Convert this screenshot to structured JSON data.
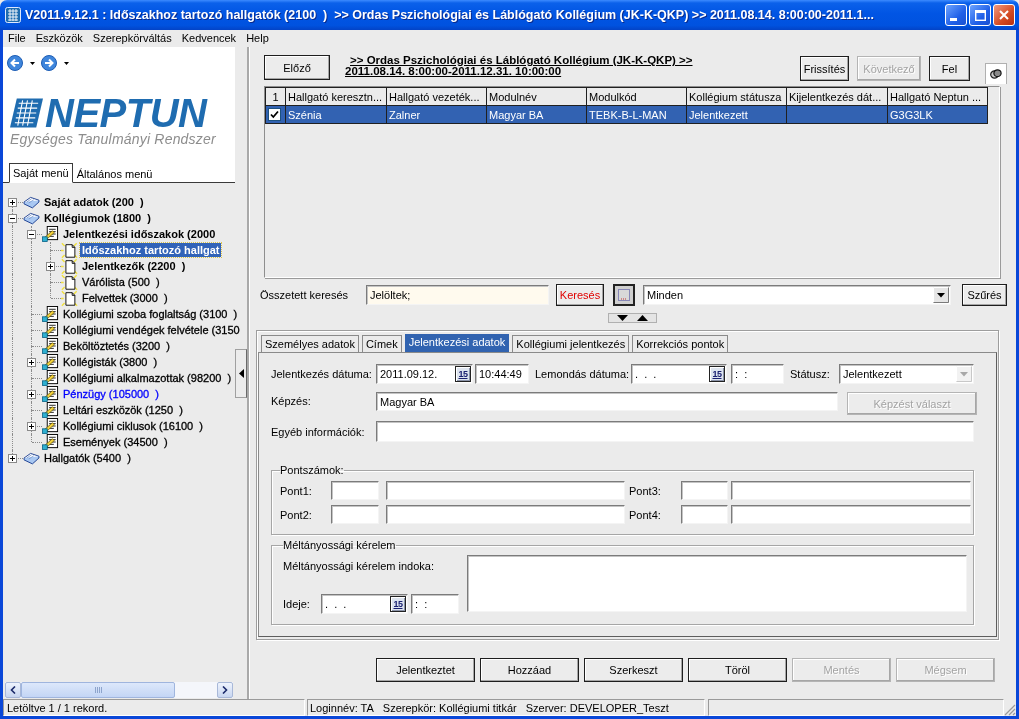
{
  "window": {
    "title": "V2011.9.12.1 : Időszakhoz tartozó hallgatók (2100  )  >> Ordas Pszichológiai és Láblógató Kollégium (JK-K-QKP) >> 2011.08.14. 8:00:00-2011.1..."
  },
  "menu": [
    "File",
    "Eszközök",
    "Szerepkörváltás",
    "Kedvencek",
    "Help"
  ],
  "sidebar": {
    "logo": {
      "name": "NEPTUN",
      "tagline": "Egységes Tanulmányi Rendszer"
    },
    "tabs": [
      {
        "label": "Saját menü",
        "selected": true
      },
      {
        "label": "Általános menü",
        "selected": false
      }
    ],
    "tree": [
      {
        "label": "Saját adatok (200  )",
        "kind": "book",
        "bold": true,
        "color": "#000000",
        "expanded": false,
        "selected": false
      },
      {
        "label": "Kollégiumok (1800  )",
        "kind": "book",
        "bold": true,
        "color": "#000000",
        "expanded": true,
        "selected": false,
        "children": [
          {
            "label": "Jelentkezési időszakok (2000",
            "kind": "form",
            "bold": true,
            "color": "#000000",
            "expanded": true,
            "selected": false,
            "children": [
              {
                "label": "Időszakhoz tartozó hallgat",
                "kind": "page",
                "bold": true,
                "selected": true
              },
              {
                "label": "Jelentkezők (2200  )",
                "kind": "page",
                "bold": true,
                "color": "#000000",
                "expanded": false,
                "selected": false
              },
              {
                "label": "Várólista (500  )",
                "kind": "page",
                "bold": false,
                "color": "#000000",
                "selected": false
              },
              {
                "label": "Felvettek (3000  )",
                "kind": "page",
                "bold": false,
                "color": "#000000",
                "selected": false
              }
            ]
          },
          {
            "label": "Kollégiumi szoba foglaltság (3100  )",
            "kind": "form",
            "bold": false,
            "color": "#000000",
            "selected": false
          },
          {
            "label": "Kollégiumi vendégek felvétele (3150",
            "kind": "form",
            "bold": false,
            "color": "#000000",
            "selected": false
          },
          {
            "label": "Beköltöztetés (3200  )",
            "kind": "form",
            "bold": false,
            "color": "#000000",
            "selected": false
          },
          {
            "label": "Kollégisták (3800  )",
            "kind": "form",
            "bold": false,
            "color": "#000000",
            "expanded": false,
            "selected": false
          },
          {
            "label": "Kollégiumi alkalmazottak (98200  )",
            "kind": "form",
            "bold": false,
            "color": "#000000",
            "selected": false
          },
          {
            "label": "Pénzügy (105000  )",
            "kind": "form",
            "bold": false,
            "color": "#0000ff",
            "expanded": false,
            "selected": false
          },
          {
            "label": "Leltári eszközök (1250  )",
            "kind": "form",
            "bold": false,
            "color": "#000000",
            "selected": false
          },
          {
            "label": "Kollégiumi ciklusok (16100  )",
            "kind": "form",
            "bold": false,
            "color": "#000000",
            "expanded": false,
            "selected": false
          },
          {
            "label": "Események (34500  )",
            "kind": "form",
            "bold": false,
            "color": "#000000",
            "selected": false
          }
        ]
      },
      {
        "label": "Hallgatók (5400  )",
        "kind": "book",
        "bold": false,
        "color": "#000000",
        "expanded": false,
        "selected": false
      }
    ]
  },
  "toolbar": {
    "prev_button": {
      "label": "Előző",
      "disabled": false
    },
    "breadcrumb": [
      ">> Ordas Pszichológiai és Láblógató Kollégium (JK-K-QKP) >>",
      "2011.08.14. 8:00:00-2011.12.31. 10:00:00"
    ],
    "buttons": [
      {
        "label": "Frissítés",
        "disabled": false
      },
      {
        "label": "Következő",
        "disabled": true
      },
      {
        "label": "Fel",
        "disabled": false
      }
    ]
  },
  "table": {
    "corner": "1",
    "columns": [
      "Hallgató keresztn...",
      "Hallgató vezeték...",
      "Modulnév",
      "Modulkód",
      "Kollégium státusza",
      "Kijelentkezés dát...",
      "Hallgató Neptun ..."
    ],
    "rows": [
      {
        "checked": true,
        "selected": true,
        "cells": [
          "Szénia",
          "Zalner",
          "Magyar BA",
          "TEBK-B-L-MAN",
          "Jelentkezett",
          "",
          "G3G3LK"
        ]
      }
    ]
  },
  "search": {
    "label": "Összetett keresés",
    "value": "Jelöltek;",
    "search_button": "Keresés",
    "filter": "Minden",
    "filter_button": "Szűrés"
  },
  "detail_tabs": [
    {
      "label": "Személyes adatok",
      "selected": false
    },
    {
      "label": "Címek",
      "selected": false
    },
    {
      "label": "Jelentkezési adatok",
      "selected": true
    },
    {
      "label": "Kollégiumi jelentkezés",
      "selected": false
    },
    {
      "label": "Korrekciós pontok",
      "selected": false
    }
  ],
  "form": {
    "registration": {
      "label": "Jelentkezés dátuma:",
      "date": "2011.09.12.",
      "calendar": "15",
      "time": "10:44:49"
    },
    "cancellation": {
      "label": "Lemondás dátuma:",
      "date": ".  .  .",
      "calendar": "15",
      "time": ":  :"
    },
    "status": {
      "label": "Státusz:",
      "value": "Jelentkezett",
      "disabled": true
    },
    "program": {
      "label": "Képzés:",
      "value": "Magyar BA",
      "button": {
        "label": "Képzést választ",
        "disabled": true
      }
    },
    "other_info": {
      "label": "Egyéb információk:"
    },
    "points": {
      "legend": "Pontszámok:",
      "items": [
        {
          "label": "Pont1:"
        },
        {
          "label": "Pont3:"
        },
        {
          "label": "Pont2:"
        },
        {
          "label": "Pont4:"
        }
      ]
    },
    "equity": {
      "legend": "Méltányossági kérelem",
      "reason_label": "Méltányossági kérelem indoka:",
      "date_label": "Ideje:",
      "date": ".  .  .",
      "calendar": "15",
      "time": ":  :"
    }
  },
  "actions": [
    {
      "label": "Jelentkeztet",
      "disabled": false
    },
    {
      "label": "Hozzáad",
      "disabled": false
    },
    {
      "label": "Szerkeszt",
      "disabled": false
    },
    {
      "label": "Töröl",
      "disabled": false
    },
    {
      "label": "Mentés",
      "disabled": true
    },
    {
      "label": "Mégsem",
      "disabled": true
    }
  ],
  "status_bar": {
    "message": "Letöltve 1 / 1 rekord.",
    "items": [
      "Loginnév: TA",
      "Szerepkör: Kollégiumi titkár",
      "Szerver: DEVELOPER_Teszt"
    ]
  }
}
